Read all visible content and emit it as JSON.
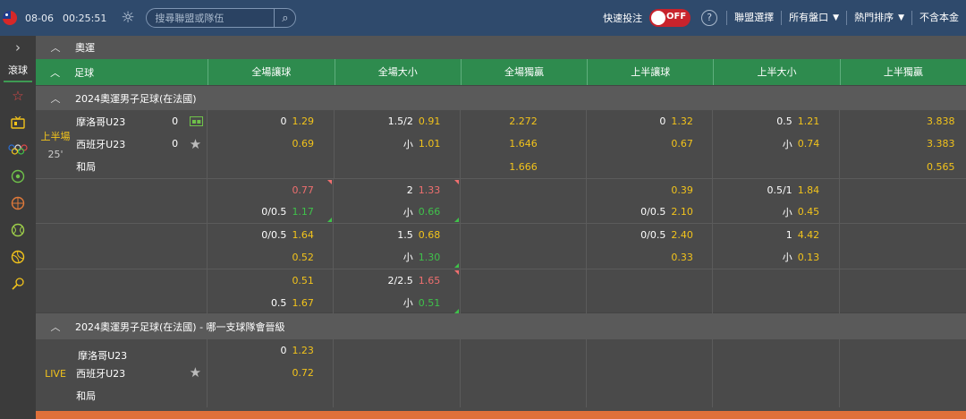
{
  "topbar": {
    "date": "08-06",
    "time": "00:25:51",
    "search_placeholder": "搜尋聯盟或隊伍",
    "quick_bet": "快速投注",
    "toggle_label": "OFF",
    "help": "?",
    "league_select": "聯盟選擇",
    "all_markets": "所有盤口",
    "hot_sort": "熱門排序",
    "exclude_principal": "不含本金"
  },
  "sidebar": {
    "live_label": "滾球",
    "icons": [
      "chevron-right-icon",
      "star-icon",
      "tv-icon",
      "olympic-rings-icon",
      "soccer-ball-icon",
      "basketball-icon",
      "tennis-ball-icon",
      "volleyball-icon",
      "badminton-icon"
    ]
  },
  "section": {
    "title": "奧運"
  },
  "header": {
    "sport": "足球",
    "cols": [
      "全場讓球",
      "全場大小",
      "全場獨贏",
      "上半讓球",
      "上半大小",
      "上半獨贏"
    ]
  },
  "league1": {
    "title": "2024奧運男子足球(在法國)",
    "period": "上半場",
    "minute": "25'",
    "home": "摩洛哥U23",
    "away": "西班牙U23",
    "draw": "和局",
    "home_score": "0",
    "away_score": "0",
    "main_rows": [
      {
        "fh_hc": "0",
        "fh_pr": "1.29",
        "ou_hc": "1.5/2",
        "ou_pr": "0.91",
        "ml": "2.272",
        "h1_hc": "0",
        "h1_pr": "1.32",
        "h1ou_hc": "0.5",
        "h1ou_pr": "1.21",
        "h1ml": "3.838"
      },
      {
        "fh_hc": "",
        "fh_pr": "0.69",
        "ou_hc": "小",
        "ou_pr": "1.01",
        "ml": "1.646",
        "h1_hc": "",
        "h1_pr": "0.67",
        "h1ou_hc": "小",
        "h1ou_pr": "0.74",
        "h1ml": "3.383"
      },
      {
        "fh_hc": "",
        "fh_pr": "",
        "ou_hc": "",
        "ou_pr": "",
        "ml": "1.666",
        "h1_hc": "",
        "h1_pr": "",
        "h1ou_hc": "",
        "h1ou_pr": "",
        "h1ml": "0.565"
      }
    ],
    "extra_rows": [
      {
        "fh_hc": "",
        "fh_pr": "0.77",
        "ou_hc": "2",
        "ou_pr": "1.33",
        "h1_hc": "",
        "h1_pr": "0.39",
        "h1ou_hc": "0.5/1",
        "h1ou_pr": "1.84"
      },
      {
        "fh_hc": "0/0.5",
        "fh_pr": "1.17",
        "ou_hc": "小",
        "ou_pr": "0.66",
        "h1_hc": "0/0.5",
        "h1_pr": "2.10",
        "h1ou_hc": "小",
        "h1ou_pr": "0.45"
      },
      {
        "fh_hc": "0/0.5",
        "fh_pr": "1.64",
        "ou_hc": "1.5",
        "ou_pr": "0.68",
        "h1_hc": "0/0.5",
        "h1_pr": "2.40",
        "h1ou_hc": "1",
        "h1ou_pr": "4.42"
      },
      {
        "fh_hc": "",
        "fh_pr": "0.52",
        "ou_hc": "小",
        "ou_pr": "1.30",
        "h1_hc": "",
        "h1_pr": "0.33",
        "h1ou_hc": "小",
        "h1ou_pr": "0.13"
      },
      {
        "fh_hc": "",
        "fh_pr": "0.51",
        "ou_hc": "2/2.5",
        "ou_pr": "1.65",
        "h1_hc": "",
        "h1_pr": "",
        "h1ou_hc": "",
        "h1ou_pr": ""
      },
      {
        "fh_hc": "0.5",
        "fh_pr": "1.67",
        "ou_hc": "小",
        "ou_pr": "0.51",
        "h1_hc": "",
        "h1_pr": "",
        "h1ou_hc": "",
        "h1ou_pr": ""
      }
    ]
  },
  "league2": {
    "title": "2024奧運男子足球(在法國) - 哪一支球隊會晉級",
    "live": "LIVE",
    "home": "摩洛哥U23",
    "away": "西班牙U23",
    "draw": "和局",
    "row1_hc": "0",
    "row1_pr": "1.23",
    "row2_pr": "0.72"
  },
  "colors": {
    "topbar": "#2f4a6c",
    "header_green": "#2e8b4e",
    "odds_yellow": "#f2c31b",
    "odds_red": "#ef6f6f",
    "odds_green": "#3fc24a",
    "toggle_red": "#c8232c"
  }
}
